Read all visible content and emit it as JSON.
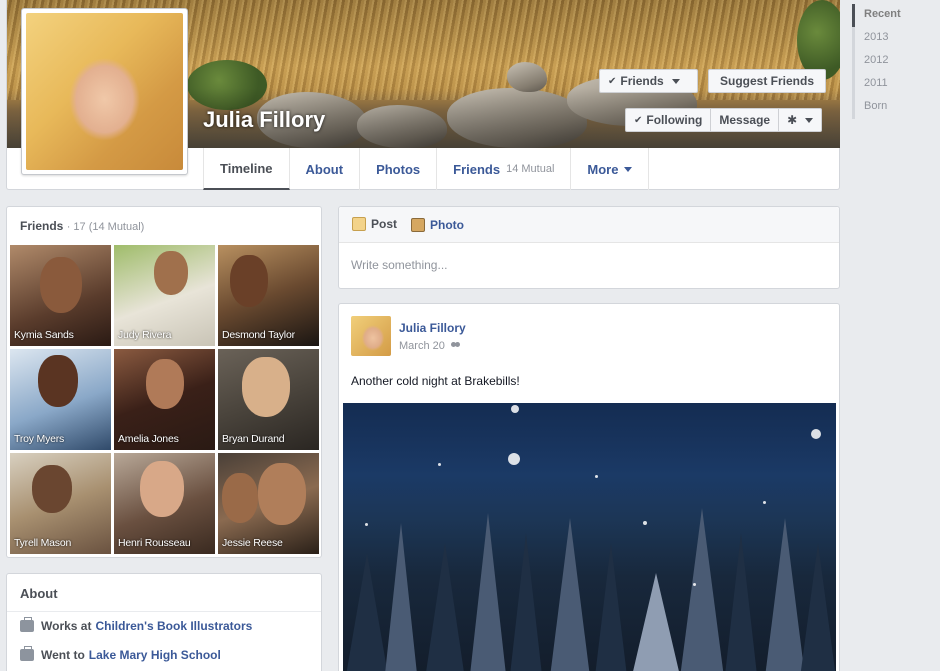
{
  "profile": {
    "name": "Julia Fillory",
    "buttons": {
      "friends": "Friends",
      "suggest": "Suggest Friends",
      "following": "Following",
      "message": "Message"
    }
  },
  "tabs": [
    {
      "label": "Timeline",
      "sub": ""
    },
    {
      "label": "About",
      "sub": ""
    },
    {
      "label": "Photos",
      "sub": ""
    },
    {
      "label": "Friends",
      "sub": "14 Mutual"
    },
    {
      "label": "More",
      "sub": ""
    }
  ],
  "timeline_rail": [
    "Recent",
    "2013",
    "2012",
    "2011",
    "Born"
  ],
  "friends_card": {
    "title": "Friends",
    "count": "· 17 (14 Mutual)",
    "friends": [
      "Kymia Sands",
      "Judy Rivera",
      "Desmond Taylor",
      "Troy Myers",
      "Amelia Jones",
      "Bryan Durand",
      "Tyrell Mason",
      "Henri Rousseau",
      "Jessie Reese"
    ]
  },
  "about_card": {
    "title": "About",
    "rows": [
      {
        "prefix": "Works at",
        "link": "Children's Book Illustrators"
      },
      {
        "prefix": "Went to",
        "link": "Lake Mary High School"
      }
    ]
  },
  "composer": {
    "post_tab": "Post",
    "photo_tab": "Photo",
    "placeholder": "Write something..."
  },
  "post": {
    "author": "Julia Fillory",
    "date": "March 20",
    "text": "Another cold night at Brakebills!"
  },
  "colors": {
    "link": "#3b5998",
    "background": "#e9ebee"
  }
}
